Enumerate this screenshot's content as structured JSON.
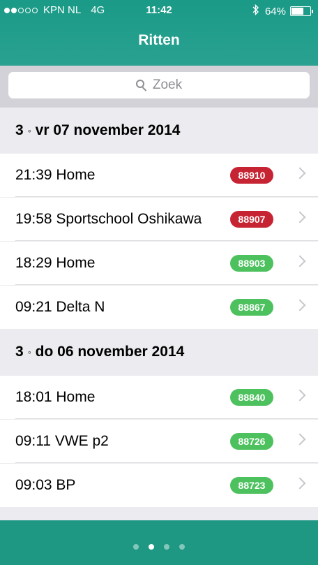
{
  "status_bar": {
    "signal_full": 2,
    "signal_total": 5,
    "carrier": "KPN NL",
    "network": "4G",
    "time": "11:42",
    "bluetooth_icon": "bluetooth-icon",
    "battery_text": "64%",
    "battery_level": 0.64
  },
  "header": {
    "title": "Ritten"
  },
  "search": {
    "placeholder": "Zoek",
    "icon": "search-icon"
  },
  "sections": [
    {
      "count": "3",
      "separator": "◦",
      "date": "vr 07 november 2014",
      "rows": [
        {
          "text": "21:39 Home",
          "badge": "88910",
          "badge_color": "#c72433"
        },
        {
          "text": "19:58 Sportschool Oshikawa",
          "badge": "88907",
          "badge_color": "#c72433"
        },
        {
          "text": "18:29 Home",
          "badge": "88903",
          "badge_color": "#4cc15e"
        },
        {
          "text": "09:21 Delta N",
          "badge": "88867",
          "badge_color": "#4cc15e"
        }
      ]
    },
    {
      "count": "3",
      "separator": "◦",
      "date": "do 06 november 2014",
      "rows": [
        {
          "text": "18:01 Home",
          "badge": "88840",
          "badge_color": "#4cc15e"
        },
        {
          "text": "09:11 VWE p2",
          "badge": "88726",
          "badge_color": "#4cc15e"
        },
        {
          "text": "09:03 BP",
          "badge": "88723",
          "badge_color": "#4cc15e"
        }
      ]
    }
  ],
  "pager": {
    "pages": 4,
    "active_index": 1
  },
  "colors": {
    "header": "#1a9a87",
    "footer": "#1e9883",
    "red": "#c72433",
    "green": "#4cc15e"
  }
}
